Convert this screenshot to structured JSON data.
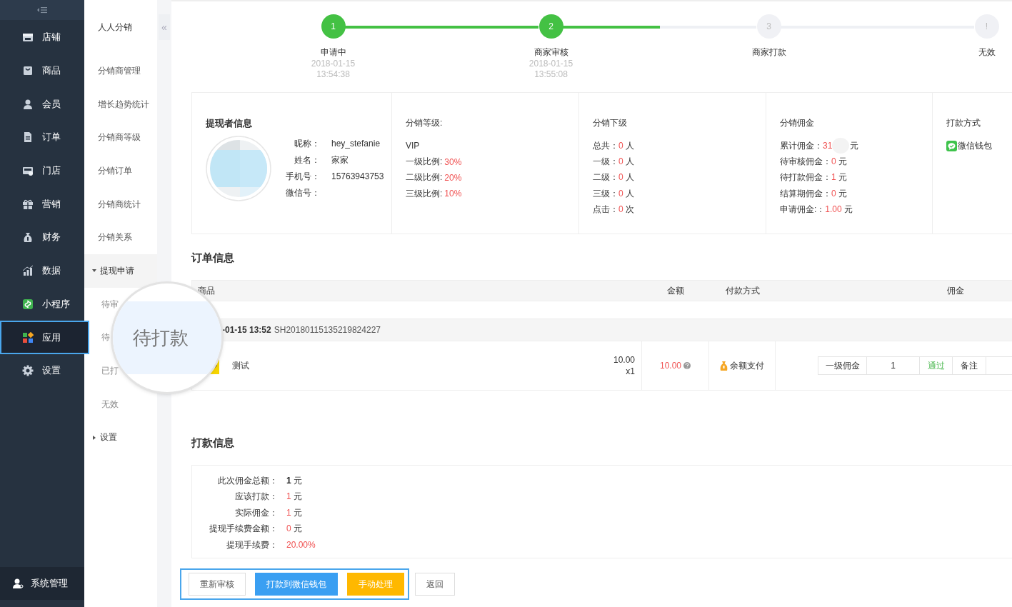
{
  "main_nav": [
    {
      "label": "店铺",
      "selected": false
    },
    {
      "label": "商品",
      "selected": false
    },
    {
      "label": "会员",
      "selected": false
    },
    {
      "label": "订单",
      "selected": false
    },
    {
      "label": "门店",
      "selected": false
    },
    {
      "label": "营销",
      "selected": false
    },
    {
      "label": "财务",
      "selected": false
    },
    {
      "label": "数据",
      "selected": false
    },
    {
      "label": "小程序",
      "selected": false
    },
    {
      "label": "应用",
      "selected": true
    },
    {
      "label": "设置",
      "selected": false
    }
  ],
  "system_nav": {
    "label": "系统管理"
  },
  "sub_nav": {
    "title": "人人分销",
    "collapse": "«",
    "items": [
      {
        "label": "分销商管理",
        "kind": "link"
      },
      {
        "label": "增长趋势统计",
        "kind": "link"
      },
      {
        "label": "分销商等级",
        "kind": "link"
      },
      {
        "label": "分销订单",
        "kind": "link"
      },
      {
        "label": "分销商统计",
        "kind": "link"
      },
      {
        "label": "分销关系",
        "kind": "link"
      },
      {
        "label": "提现申请",
        "kind": "group",
        "expanded": true,
        "children": [
          {
            "label": "待审"
          },
          {
            "label": "待"
          },
          {
            "label": "已打"
          },
          {
            "label": "无效"
          }
        ]
      },
      {
        "label": "设置",
        "kind": "group",
        "expanded": false
      }
    ]
  },
  "magnifier": {
    "text": "待打款"
  },
  "steps": {
    "connectors": [
      {
        "level": 1
      },
      {
        "level": 0.5
      }
    ],
    "items": [
      {
        "number": "1",
        "label": "申请中",
        "date": "2018-01-15",
        "time": "13:54:38",
        "done": true
      },
      {
        "number": "2",
        "label": "商家审核",
        "date": "2018-01-15",
        "time": "13:55:08",
        "done": true
      },
      {
        "number": "3",
        "label": "商家打款",
        "done": false
      },
      {
        "number": "!",
        "label": "无效",
        "done": false
      }
    ]
  },
  "withdrawer": {
    "title": "提现者信息",
    "fields": [
      {
        "label": "昵称：",
        "value": "hey_stefanie"
      },
      {
        "label": "姓名：",
        "value": "家家"
      },
      {
        "label": "手机号：",
        "value": "15763943753"
      },
      {
        "label": "微信号："
      }
    ]
  },
  "level": {
    "title": "分销等级:",
    "value": "VIP",
    "rates": [
      {
        "label": "一级比例:",
        "value": "30%"
      },
      {
        "label": "二级比例:",
        "value": "20%"
      },
      {
        "label": "三级比例:",
        "value": "10%"
      }
    ]
  },
  "subordinates": {
    "title": "分销下级",
    "rows": [
      {
        "label": "总共：",
        "value": "0",
        "unit": "人"
      },
      {
        "label": "一级：",
        "value": "0",
        "unit": "人"
      },
      {
        "label": "二级：",
        "value": "0",
        "unit": "人"
      },
      {
        "label": "三级：",
        "value": "0",
        "unit": "人"
      },
      {
        "label": "点击：",
        "value": "0",
        "unit": "次"
      }
    ]
  },
  "commission": {
    "title": "分销佣金",
    "rows": [
      {
        "label": "累计佣金：",
        "value": "31",
        "unit": "元",
        "masked": true
      },
      {
        "label": "待审核佣金：",
        "value": "0",
        "unit": "元",
        "masked": false
      },
      {
        "label": "待打款佣金：",
        "value": "1",
        "unit": "元",
        "masked": false
      },
      {
        "label": "结算期佣金：",
        "value": "0",
        "unit": "元",
        "masked": false
      },
      {
        "label": "申请佣金:：",
        "value": "1.00",
        "unit": "元",
        "masked": false
      }
    ]
  },
  "payout_method": {
    "title": "打款方式",
    "method": "微信钱包"
  },
  "order": {
    "heading": "订单信息",
    "columns": [
      "商品",
      "金额",
      "付款方式",
      "佣金"
    ],
    "group": {
      "date": "-01-15 13:52",
      "order_no": "SH20180115135219824227"
    },
    "item": {
      "name": "测试",
      "price": "10.00",
      "qty": "x1",
      "amount": "10.00",
      "payment": "余额支付",
      "commission_level": "一级佣金",
      "commission_value": "1",
      "approve": "通过",
      "note": "备注"
    }
  },
  "payout": {
    "heading": "打款信息",
    "rows": [
      {
        "label": "此次佣金总额：",
        "value": "1",
        "unit": "元",
        "kind": "bold"
      },
      {
        "label": "应该打款：",
        "value": "1",
        "unit": "元",
        "kind": "red"
      },
      {
        "label": "实际佣金：",
        "value": "1",
        "unit": "元",
        "kind": "red"
      },
      {
        "label": "提现手续费金额：",
        "value": "0",
        "unit": "元",
        "kind": "red"
      },
      {
        "label": "提现手续费：",
        "value": "20.00%",
        "kind": "red"
      }
    ]
  },
  "buttons": {
    "framed": [
      {
        "label": "重新审核",
        "kind": "default"
      },
      {
        "label": "打款到微信钱包",
        "kind": "primary"
      },
      {
        "label": "手动处理",
        "kind": "warning"
      }
    ],
    "others": [
      {
        "label": "返回",
        "kind": "default"
      }
    ]
  }
}
